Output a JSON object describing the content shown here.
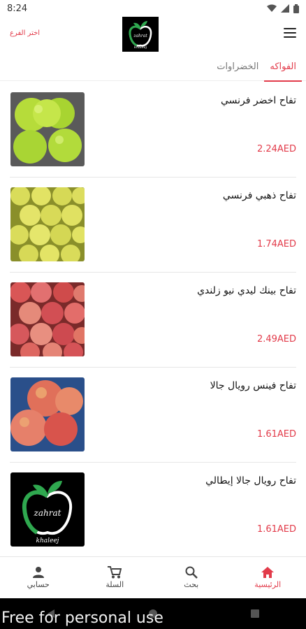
{
  "status_bar": {
    "time": "8:24",
    "icons": [
      "wifi-icon",
      "signal-icon",
      "battery-icon"
    ]
  },
  "header": {
    "branch_link": "اختر الفرع",
    "logo_text_top": "zahrat",
    "logo_text_bottom": "khaleej",
    "menu_icon": "hamburger-icon"
  },
  "tabs": [
    {
      "label": "الفواكه",
      "active": true
    },
    {
      "label": "الخضراوات",
      "active": false
    }
  ],
  "products": [
    {
      "name": "تفاح اخضر فرنسي",
      "price": "2.24AED",
      "image": "green-apples"
    },
    {
      "name": "تفاح ذهبي فرنسي",
      "price": "1.74AED",
      "image": "golden-apples"
    },
    {
      "name": "تفاح بينك ليدي نيو زلندي",
      "price": "2.49AED",
      "image": "pink-lady-apples"
    },
    {
      "name": "تفاح فينس رويال جالا",
      "price": "1.61AED",
      "image": "royal-gala-apples"
    },
    {
      "name": "تفاح رويال جالا إيطالي",
      "price": "1.61AED",
      "image": "store-logo"
    }
  ],
  "bottom_nav": [
    {
      "label": "الرئيسية",
      "icon": "home-icon",
      "active": true
    },
    {
      "label": "بحث",
      "icon": "search-icon",
      "active": false
    },
    {
      "label": "السلة",
      "icon": "cart-icon",
      "active": false
    },
    {
      "label": "حسابي",
      "icon": "person-icon",
      "active": false
    }
  ],
  "watermark": "Free for personal use",
  "colors": {
    "accent": "#e23b4a",
    "logo_bg": "#000000",
    "logo_green": "#2fa84f"
  }
}
